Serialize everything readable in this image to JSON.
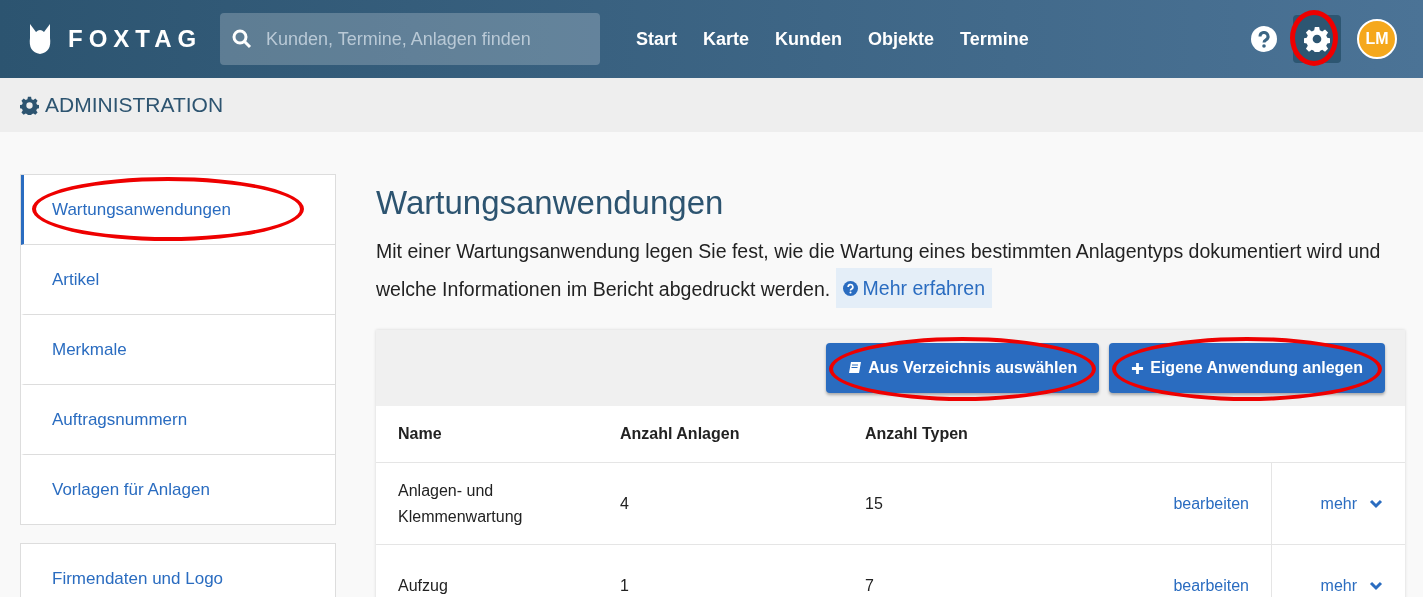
{
  "header": {
    "brand": "FOXTAG",
    "search": {
      "placeholder": "Kunden, Termine, Anlagen finden"
    },
    "nav": [
      {
        "label": "Start"
      },
      {
        "label": "Karte"
      },
      {
        "label": "Kunden"
      },
      {
        "label": "Objekte"
      },
      {
        "label": "Termine"
      }
    ],
    "actions": [
      {
        "kind": "help",
        "highlighted": false
      },
      {
        "kind": "settings",
        "highlighted": true
      }
    ],
    "avatar": "LM"
  },
  "breadcrumb": "ADMINISTRATION",
  "sidebar": {
    "groups": [
      {
        "items": [
          {
            "label": "Wartungsanwendungen",
            "selected": true,
            "highlighted": true
          },
          {
            "label": "Artikel",
            "selected": false,
            "highlighted": false
          },
          {
            "label": "Merkmale",
            "selected": false,
            "highlighted": false
          },
          {
            "label": "Auftragsnummern",
            "selected": false,
            "highlighted": false
          },
          {
            "label": "Vorlagen für Anlagen",
            "selected": false,
            "highlighted": false
          }
        ]
      },
      {
        "items": [
          {
            "label": "Firmendaten und Logo",
            "selected": false,
            "highlighted": false
          }
        ]
      }
    ]
  },
  "main": {
    "title": "Wartungsanwendungen",
    "description": "Mit einer Wartungsanwendung legen Sie fest, wie die Wartung eines bestimmten Anlagentyps dokumentiert wird und welche Informationen im Bericht abgedruckt werden.",
    "learn_more": "Mehr erfahren",
    "toolbar": [
      {
        "kind": "catalog",
        "label": "Aus Verzeichnis auswählen",
        "highlighted": true
      },
      {
        "kind": "add",
        "label": "Eigene Anwendung anlegen",
        "highlighted": true
      }
    ],
    "table": {
      "columns": [
        "Name",
        "Anzahl Anlagen",
        "Anzahl Typen"
      ],
      "rows": [
        {
          "name": "Anlagen- und Klemmenwartung",
          "anlagen": "4",
          "typen": "15",
          "edit": "bearbeiten",
          "more": "mehr"
        },
        {
          "name": "Aufzug",
          "anlagen": "1",
          "typen": "7",
          "edit": "bearbeiten",
          "more": "mehr"
        }
      ]
    }
  }
}
